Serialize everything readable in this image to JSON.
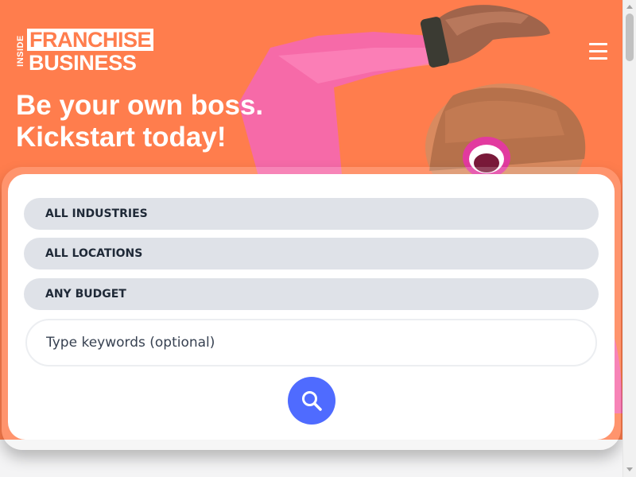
{
  "brand": {
    "logo_inside": "INSIDE",
    "logo_franchise": "FRANCHISE",
    "logo_business": "BUSINESS",
    "accent_color": "#ff7d4d",
    "button_color": "#4f6bff"
  },
  "header": {
    "menu_icon": "hamburger-menu-icon"
  },
  "hero": {
    "headline_line1": "Be your own boss.",
    "headline_line2": "Kickstart today!"
  },
  "search": {
    "industry_select": "ALL INDUSTRIES",
    "location_select": "ALL LOCATIONS",
    "budget_select": "ANY BUDGET",
    "keyword_placeholder": "Type keywords (optional)",
    "submit_icon": "search-icon"
  }
}
